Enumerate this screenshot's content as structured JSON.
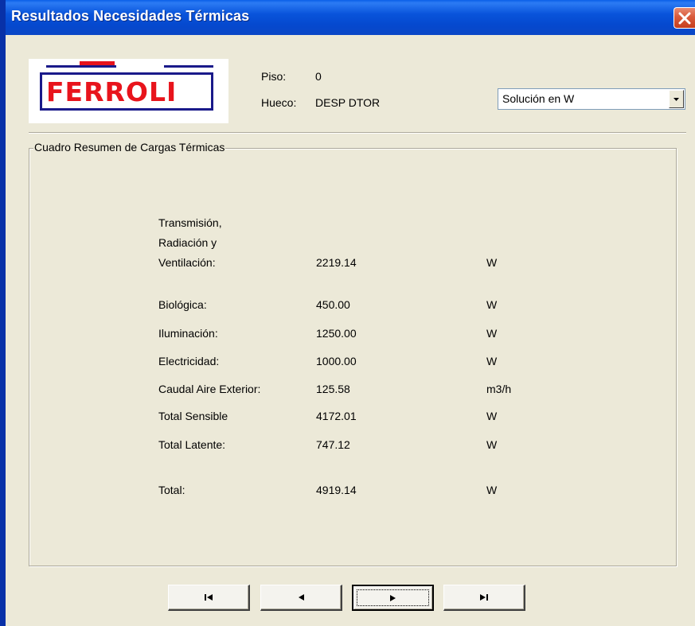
{
  "window": {
    "title": "Resultados Necesidades Térmicas"
  },
  "logo": {
    "text": "FERROLI"
  },
  "header": {
    "piso_label": "Piso:",
    "piso_value": "0",
    "hueco_label": "Hueco:",
    "hueco_value": "DESP DTOR"
  },
  "units_select": {
    "selected": "Solución en W"
  },
  "summary": {
    "title": "Cuadro Resumen de Cargas Térmicas",
    "rows": [
      {
        "label_lines": [
          "Transmisión,",
          "Radiación y",
          "Ventilación:"
        ],
        "value": "2219.14",
        "unit": "W"
      },
      {
        "label": "Biológica:",
        "value": "450.00",
        "unit": "W"
      },
      {
        "label": "Iluminación:",
        "value": "1250.00",
        "unit": "W"
      },
      {
        "label": "Electricidad:",
        "value": "1000.00",
        "unit": "W"
      },
      {
        "label": "Caudal Aire Exterior:",
        "value": "125.58",
        "unit": "m3/h"
      },
      {
        "label": "Total Sensible",
        "value": "4172.01",
        "unit": "W"
      },
      {
        "label": "Total Latente:",
        "value": "747.12",
        "unit": "W"
      },
      {
        "label": "Total:",
        "value": "4919.14",
        "unit": "W"
      }
    ]
  },
  "navigation": {
    "buttons": [
      {
        "icon": "first-record-icon"
      },
      {
        "icon": "previous-record-icon"
      },
      {
        "icon": "next-record-icon"
      },
      {
        "icon": "last-record-icon"
      }
    ]
  },
  "colors": {
    "titlebar": "#0954DB",
    "logo_red": "#E8141C",
    "logo_blue": "#1a1a8a",
    "dialog_bg": "#ECE9D8"
  }
}
